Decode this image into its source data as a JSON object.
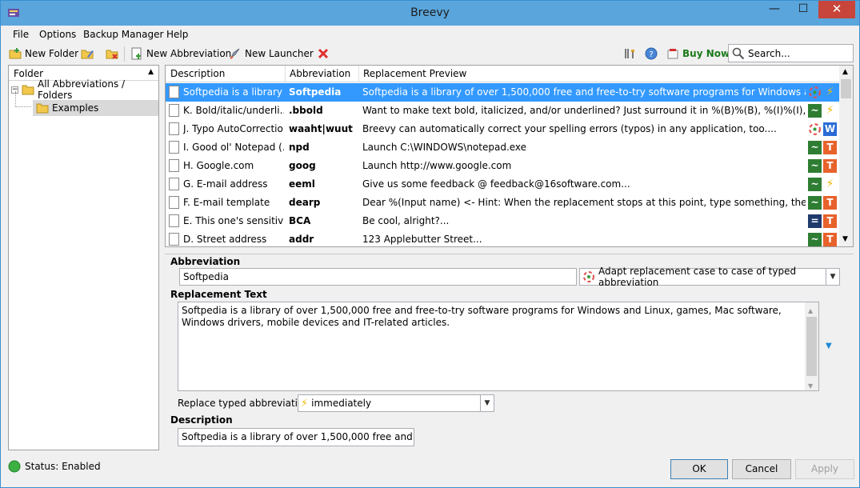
{
  "window": {
    "title": "Breevy",
    "minimize": "—",
    "maximize": "☐",
    "close": "✕"
  },
  "menu": [
    {
      "label": "File"
    },
    {
      "label": "Options"
    },
    {
      "label": "Backup Manager"
    },
    {
      "label": "Help"
    }
  ],
  "toolbar": {
    "new_folder": "New Folder",
    "new_abbreviation": "New Abbreviation",
    "new_launcher": "New Launcher",
    "buy_now": "Buy Now",
    "search_placeholder": "Search..."
  },
  "folders": {
    "header": "Folder",
    "root": "All Abbreviations / Folders",
    "child": "Examples"
  },
  "list": {
    "columns": [
      "Description",
      "Abbreviation",
      "Replacement Preview"
    ],
    "rows": [
      {
        "description": "Softpedia is a library ...",
        "abbreviation": "Softpedia",
        "preview": "Softpedia is a library of over 1,500,000 free and free-to-try software programs for Windows and Linux, g...",
        "badges": [
          "icon",
          "⚡"
        ],
        "selected": true
      },
      {
        "description": "K. Bold/italic/underli...",
        "abbreviation": ".bbold",
        "preview": "Want to make text bold, italicized, and/or underlined? Just surround it in %(B)%(B), %(I)%(I), and/or %(...",
        "badges": [
          "~",
          "⚡"
        ]
      },
      {
        "description": "J. Typo AutoCorrection",
        "abbreviation": "waaht|wuut",
        "preview": "Breevy can automatically correct your spelling errors (typos) in any application, too....",
        "badges": [
          "icon",
          "W"
        ]
      },
      {
        "description": "I. Good ol' Notepad (...",
        "abbreviation": "npd",
        "preview": "Launch C:\\WINDOWS\\notepad.exe",
        "badges": [
          "~",
          "T"
        ]
      },
      {
        "description": "H. Google.com",
        "abbreviation": "goog",
        "preview": "Launch http://www.google.com",
        "badges": [
          "~",
          "T"
        ]
      },
      {
        "description": "G. E-mail address",
        "abbreviation": "eeml",
        "preview": "Give us some feedback @ feedback@16software.com...",
        "badges": [
          "~",
          "⚡"
        ]
      },
      {
        "description": "F. E-mail template",
        "abbreviation": "dearp",
        "preview": "Dear %(Input name) <- Hint: When the replacement stops at this point, type something, then press Tab...",
        "badges": [
          "~",
          "T"
        ]
      },
      {
        "description": "E. This one's sensitive!",
        "abbreviation": "BCA",
        "preview": "Be cool, alright?...",
        "badges": [
          "=",
          "T"
        ]
      },
      {
        "description": "D. Street address",
        "abbreviation": "addr",
        "preview": "123 Applebutter Street...",
        "badges": [
          "~",
          "T"
        ]
      }
    ]
  },
  "detail": {
    "abbreviation_label": "Abbreviation",
    "abbreviation_value": "Softpedia",
    "case_option": "Adapt replacement case to case of typed abbreviation",
    "replacement_label": "Replacement Text",
    "replacement_value": "Softpedia is a library of over 1,500,000 free and free-to-try software programs for Windows and Linux, games, Mac software, Windows drivers, mobile devices and IT-related articles.",
    "replace_typed_label": "Replace typed abbreviation:",
    "replace_typed_value": "immediately",
    "description_label": "Description",
    "description_value": "Softpedia is a library of over 1,500,000 free and free-to-t"
  },
  "status": {
    "text": "Status: Enabled"
  },
  "buttons": {
    "ok": "OK",
    "cancel": "Cancel",
    "apply": "Apply"
  },
  "colors": {
    "titlebar": "#5aa5db",
    "selection": "#3399ff",
    "close": "#c7453a"
  }
}
